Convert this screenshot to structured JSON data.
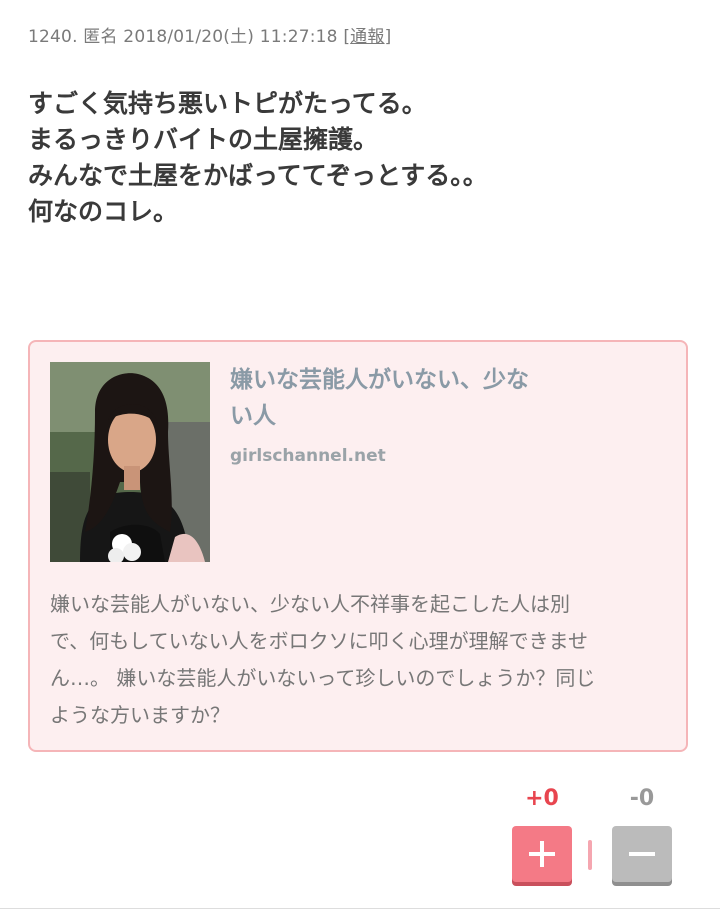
{
  "comment": {
    "number": "1240.",
    "author": "匿名",
    "datetime": "2018/01/20(土) 11:27:18",
    "report_label": "通報",
    "body_lines": [
      "すごく気持ち悪いトピがたってる。",
      "まるっきりバイトの土屋擁護。",
      "みんなで土屋をかばっててぞっとする。。",
      "何なのコレ。"
    ]
  },
  "link_card": {
    "title_lines": [
      "嫌いな芸能人がいない、少な",
      "い人"
    ],
    "domain": "girlschannel.net",
    "description_lines": [
      "嫌いな芸能人がいない、少ない人不祥事を起こした人は別",
      "で、何もしていない人をボロクソに叩く心理が理解できませ",
      "ん…。 嫌いな芸能人がいないって珍しいのでしょうか？同じ",
      "ような方いますか？"
    ],
    "thumbnail_icon": "portrait-photo"
  },
  "votes": {
    "plus_count": "+0",
    "minus_count": "-0",
    "plus_icon": "plus-icon",
    "minus_icon": "minus-icon",
    "plus_color": "#e8454f",
    "minus_color": "#999999"
  }
}
